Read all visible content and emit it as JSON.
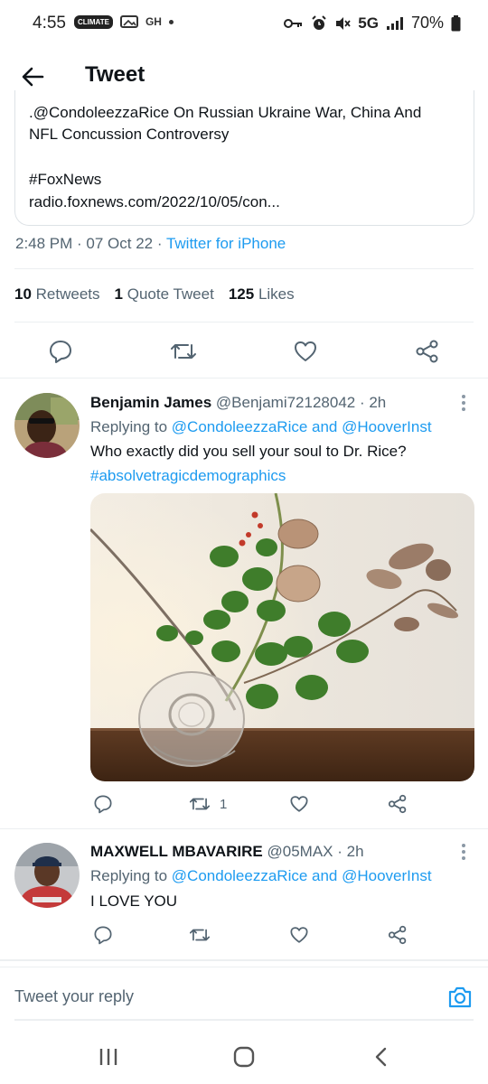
{
  "status_bar": {
    "time": "4:55",
    "badge": "CLIMATE",
    "small_icon_1": "GH",
    "network": "5G",
    "battery": "70%"
  },
  "header": {
    "title": "Tweet"
  },
  "card": {
    "line1": ".@CondoleezzaRice On Russian Ukraine War, China And",
    "line2": "NFL Concussion Controversy",
    "hashtag": "#FoxNews",
    "link": "radio.foxnews.com/2022/10/05/con..."
  },
  "meta": {
    "time": "2:48 PM",
    "sep1": " · ",
    "date": "07 Oct 22",
    "sep2": " · ",
    "source": "Twitter for iPhone"
  },
  "stats": {
    "retweets_count": "10",
    "retweets_label": "Retweets",
    "quotes_count": "1",
    "quotes_label": "Quote Tweet",
    "likes_count": "125",
    "likes_label": "Likes"
  },
  "replies": [
    {
      "name": "Benjamin James",
      "handle": "@Benjami72128042 · 2h",
      "replying_prefix": "Replying to",
      "replying_to": "@CondoleezzaRice and @HooverInst",
      "text": "Who exactly did you sell your soul to Dr. Rice?",
      "hashtag": "#absolvetragicdemographics",
      "retweet_count": "1"
    },
    {
      "name": "MAXWELL  MBAVARIRE",
      "handle": "@05MAX · 2h",
      "replying_prefix": "Replying to",
      "replying_to": "@CondoleezzaRice and @HooverInst",
      "text": "I  LOVE  YOU"
    }
  ],
  "reply_box": {
    "placeholder": "Tweet your reply"
  },
  "colors": {
    "accent": "#1d9bf0",
    "muted": "#536471",
    "text": "#0f1419"
  },
  "icons": [
    "back-arrow-icon",
    "reply-icon",
    "retweet-icon",
    "like-icon",
    "share-icon",
    "camera-icon",
    "more-icon"
  ]
}
